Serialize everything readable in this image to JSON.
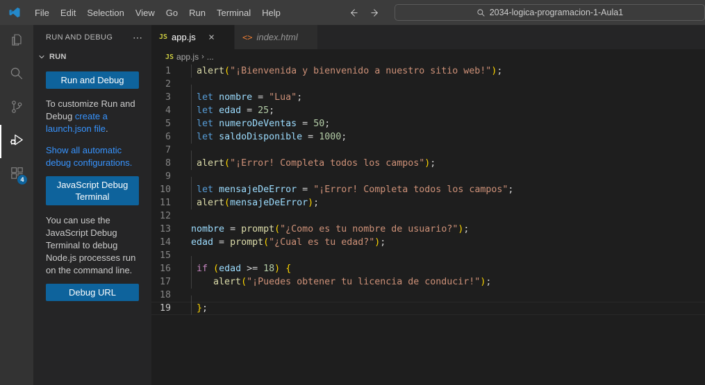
{
  "titlebar": {
    "logo_icon": "vscode-logo-icon",
    "menus": [
      "File",
      "Edit",
      "Selection",
      "View",
      "Go",
      "Run",
      "Terminal",
      "Help"
    ],
    "back_icon": "arrow-left-icon",
    "forward_icon": "arrow-right-icon",
    "command_center": {
      "search_icon": "search-icon",
      "text": "2034-logica-programacion-1-Aula1"
    }
  },
  "activitybar": {
    "items": [
      {
        "name": "explorer",
        "icon": "files-icon",
        "active": false,
        "badge": ""
      },
      {
        "name": "search",
        "icon": "search-icon",
        "active": false,
        "badge": ""
      },
      {
        "name": "source-control",
        "icon": "source-control-icon",
        "active": false,
        "badge": ""
      },
      {
        "name": "run-and-debug",
        "icon": "debug-alt-icon",
        "active": true,
        "badge": ""
      },
      {
        "name": "extensions",
        "icon": "extensions-icon",
        "active": false,
        "badge": "4"
      }
    ]
  },
  "sidebar": {
    "title": "RUN AND DEBUG",
    "more_icon": "ellipsis-icon",
    "section": {
      "chevron_icon": "chevron-down-icon",
      "title": "RUN"
    },
    "run_and_debug_button": "Run and Debug",
    "customize_text_1": "To customize Run and Debug ",
    "customize_link_1": "create a launch.json file",
    "customize_text_2": ".",
    "show_all_link": "Show all automatic debug configurations.",
    "js_debug_terminal_button": "JavaScript Debug Terminal",
    "js_debug_help": "You can use the JavaScript Debug Terminal to debug Node.js processes run on the command line.",
    "debug_url_button": "Debug URL"
  },
  "editor": {
    "tabs": [
      {
        "label": "app.js",
        "icon": "js-file-icon",
        "active": true,
        "preview": false,
        "close_icon": "close-icon"
      },
      {
        "label": "index.html",
        "icon": "html-file-icon",
        "active": false,
        "preview": true,
        "close_icon": "close-icon"
      }
    ],
    "breadcrumb": {
      "icon": "js-file-icon",
      "file": "app.js",
      "separator": "›",
      "more": "..."
    },
    "current_line": 19,
    "code": [
      {
        "n": 1,
        "indent_guide": true,
        "text": " alert(\"¡Bienvenida y bienvenido a nuestro sitio web!\");"
      },
      {
        "n": 2,
        "indent_guide": true,
        "text": ""
      },
      {
        "n": 3,
        "indent_guide": true,
        "text": " let nombre = \"Lua\";"
      },
      {
        "n": 4,
        "indent_guide": true,
        "text": " let edad = 25;"
      },
      {
        "n": 5,
        "indent_guide": true,
        "text": " let numeroDeVentas = 50;"
      },
      {
        "n": 6,
        "indent_guide": true,
        "text": " let saldoDisponible = 1000;"
      },
      {
        "n": 7,
        "indent_guide": true,
        "text": ""
      },
      {
        "n": 8,
        "indent_guide": true,
        "text": " alert(\"¡Error! Completa todos los campos\");"
      },
      {
        "n": 9,
        "indent_guide": true,
        "text": ""
      },
      {
        "n": 10,
        "indent_guide": true,
        "text": " let mensajeDeError = \"¡Error! Completa todos los campos\";"
      },
      {
        "n": 11,
        "indent_guide": true,
        "text": " alert(mensajeDeError);"
      },
      {
        "n": 12,
        "indent_guide": false,
        "text": ""
      },
      {
        "n": 13,
        "indent_guide": false,
        "text": "nombre = prompt(\"¿Como es tu nombre de usuario?\");"
      },
      {
        "n": 14,
        "indent_guide": false,
        "text": "edad = prompt(\"¿Cual es tu edad?\");"
      },
      {
        "n": 15,
        "indent_guide": true,
        "text": ""
      },
      {
        "n": 16,
        "indent_guide": true,
        "text": " if (edad >= 18) {"
      },
      {
        "n": 17,
        "indent_guide": true,
        "text": "    alert(\"¡Puedes obtener tu licencia de conducir!\");"
      },
      {
        "n": 18,
        "indent_guide": true,
        "text": ""
      },
      {
        "n": 19,
        "indent_guide": true,
        "text": " };"
      }
    ]
  },
  "colors": {
    "accent": "#0e639c",
    "link": "#3794ff",
    "editor_bg": "#1e1e1e",
    "sidebar_bg": "#252526",
    "activitybar_bg": "#333333",
    "titlebar_bg": "#3c3c3c",
    "badge_bg": "#0e639c"
  }
}
